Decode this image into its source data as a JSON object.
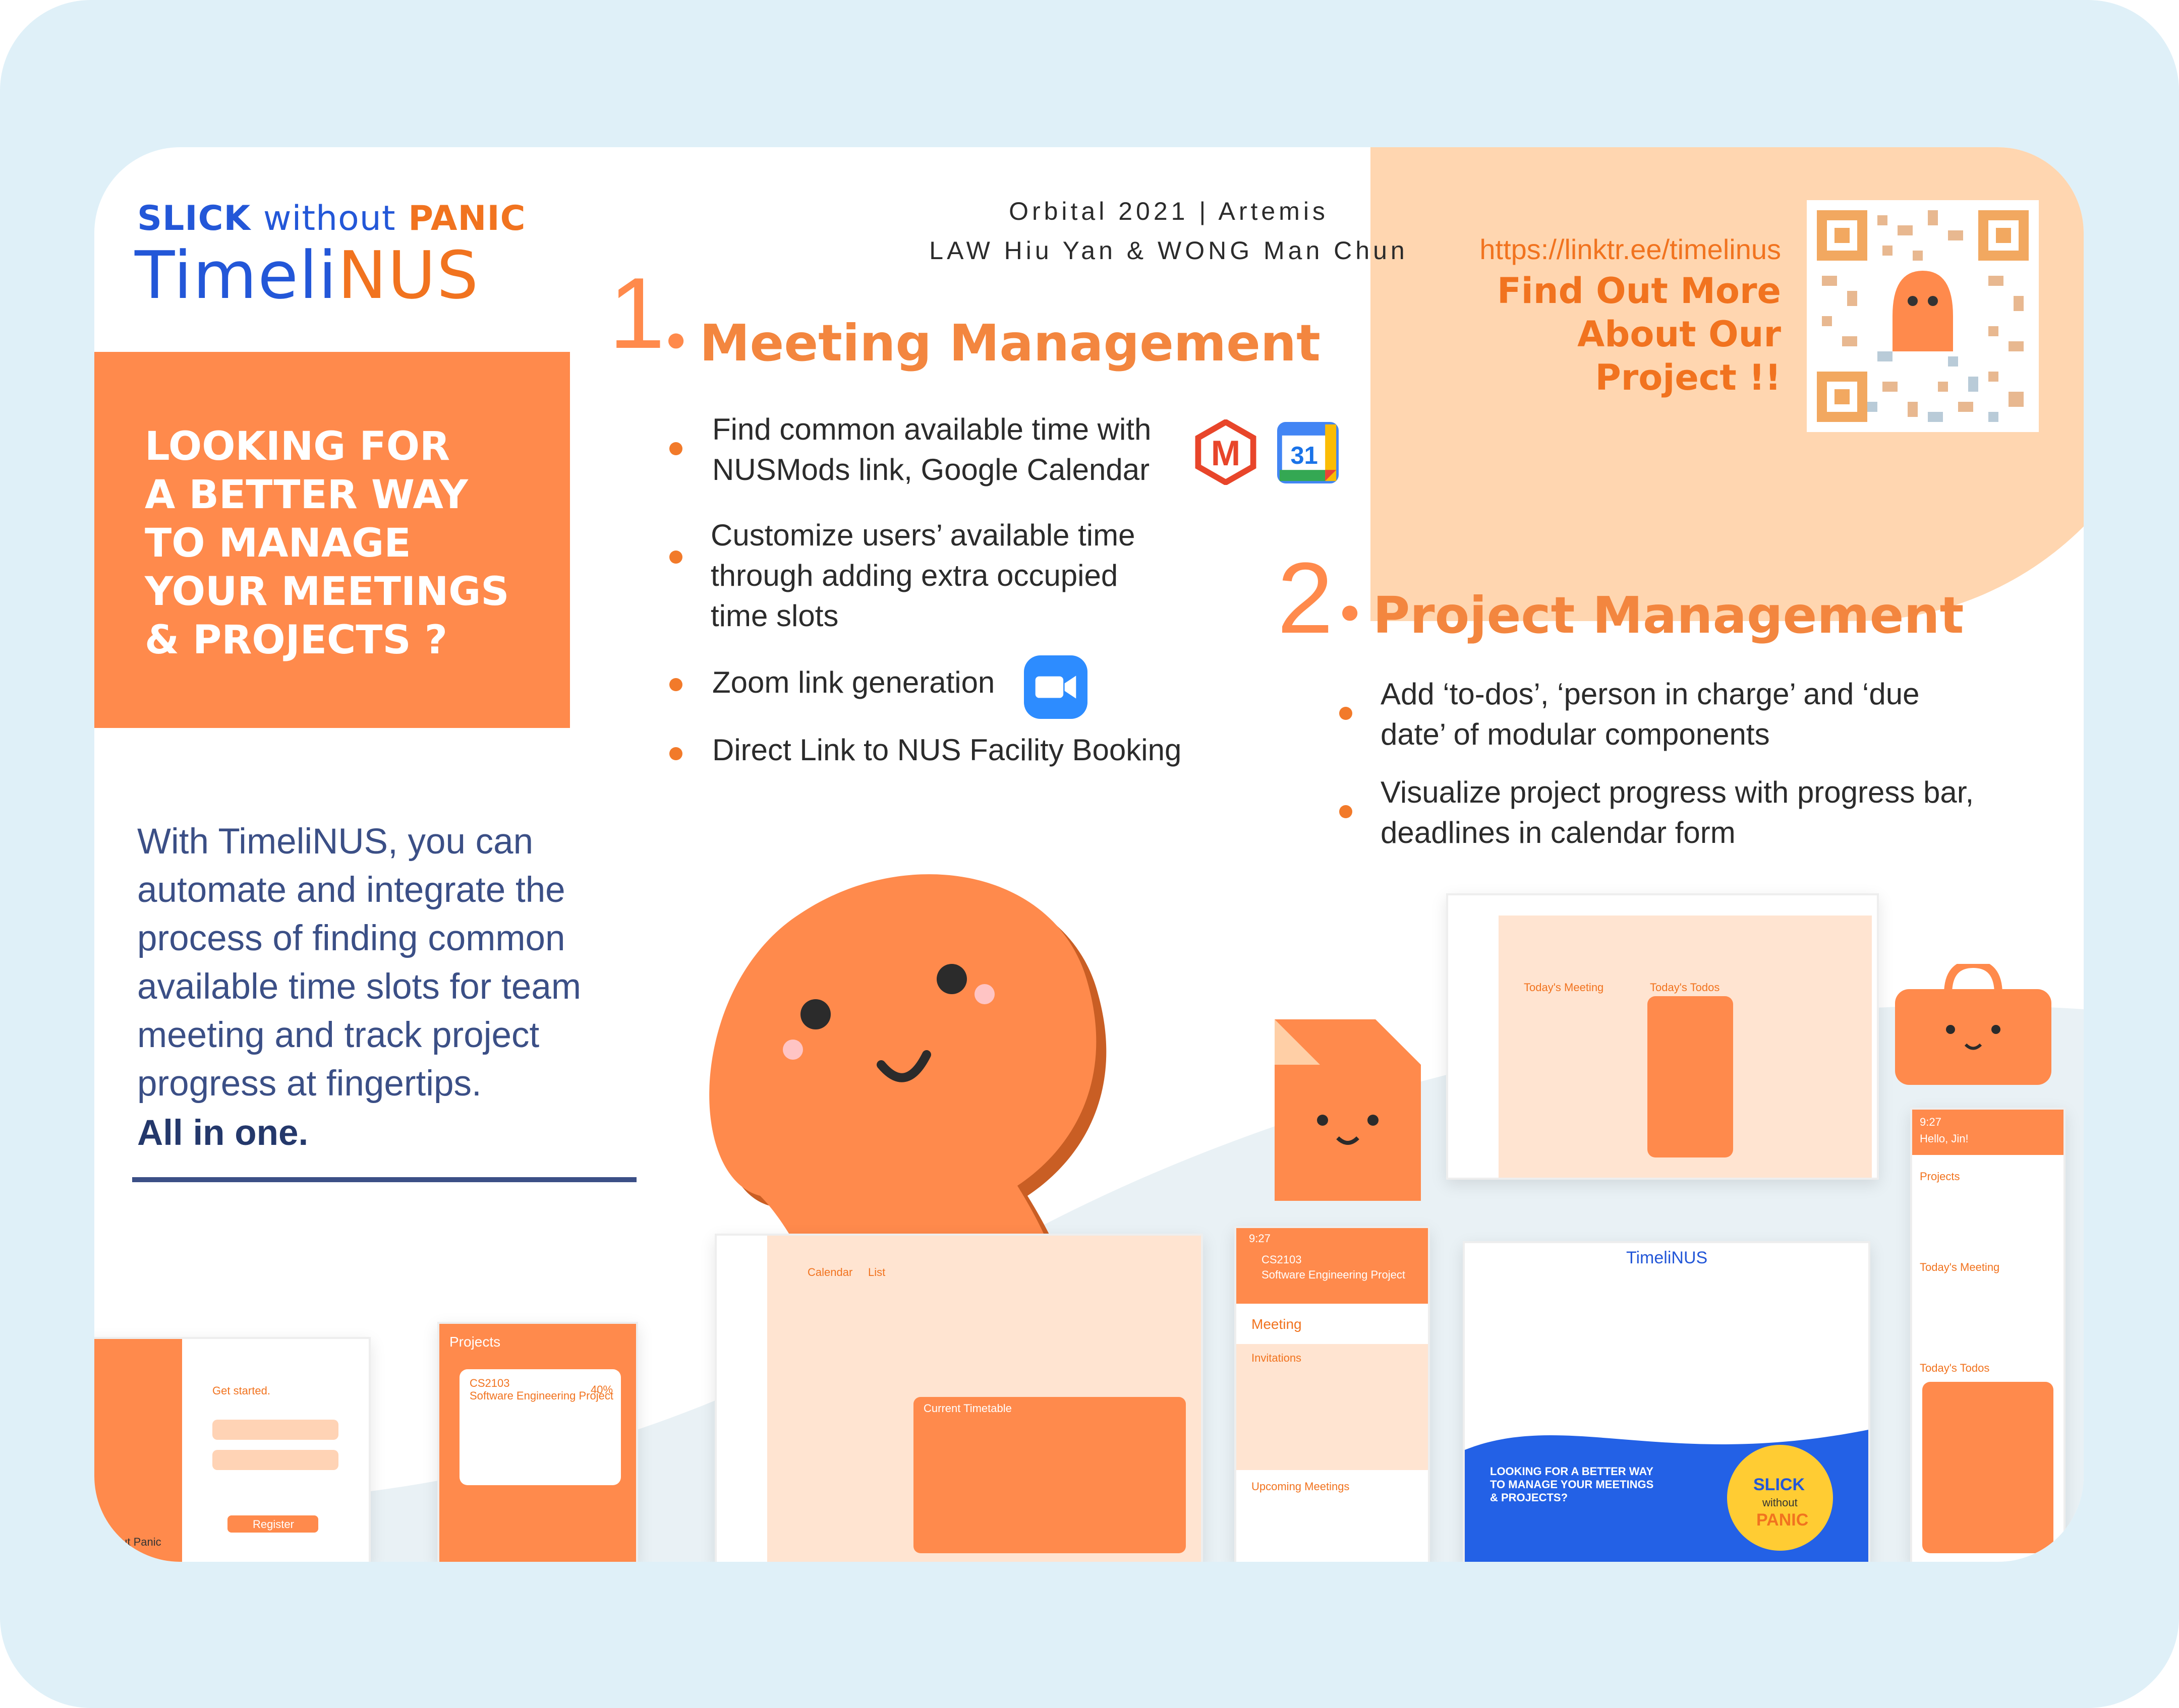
{
  "header": {
    "slick": "SLICK",
    "without": "without",
    "panic": "PANIC",
    "brand_part1": "Timeli",
    "brand_part2": "NUS",
    "orbital_line1": "Orbital 2021 | Artemis",
    "orbital_line2": "LAW Hiu Yan & WONG Man Chun"
  },
  "callout": {
    "line1": "LOOKING FOR",
    "line2": "A BETTER WAY",
    "line3": "TO MANAGE",
    "line4": "YOUR MEETINGS",
    "line5": "& PROJECTS ?"
  },
  "intro": {
    "text": "With TimeliNUS, you can automate and integrate the process of finding common available time slots for team meeting and track project progress at fingertips.",
    "strong": "All in one."
  },
  "qr": {
    "link": "https://linktr.ee/timelinus",
    "find1": "Find Out More",
    "find2": "About Our",
    "find3": "Project !!"
  },
  "section1": {
    "num": "1",
    "title": "Meeting Management",
    "bullets": [
      "Find common available time with NUSMods link, Google Calendar",
      "Customize users’ available time through adding extra occupied time slots",
      "Zoom link generation",
      "Direct Link to NUS Facility Booking"
    ],
    "icons": {
      "nusmods": "M",
      "gcal": "31"
    }
  },
  "section2": {
    "num": "2",
    "title": "Project Management",
    "bullets": [
      "Add ‘to-dos’, ‘person in charge’ and ‘due date’ of modular components",
      "Visualize project progress with progress bar, deadlines in calendar form"
    ]
  },
  "screens": {
    "get_started": "Get started.",
    "about_panic": "About Panic",
    "register": "Register",
    "projects": "Projects",
    "cs2103": "CS2103",
    "sep": "Software Engineering Project",
    "meeting": "Meeting",
    "invitations": "Invitations",
    "upcoming": "Upcoming Meetings",
    "calendar": "Calendar",
    "list": "List",
    "current_timetable": "Current Timetable",
    "hello": "Hello, Jin!",
    "todays_meeting": "Today's Meeting",
    "todays_todos": "Today's Todos",
    "looking_mini": "LOOKING FOR A BETTER WAY TO MANAGE YOUR MEETINGS & PROJECTS?",
    "slick_mini": "SLICK",
    "without_mini": "without",
    "panic_mini": "PANIC",
    "brand_mini": "TimeliNUS",
    "pct": "40%",
    "time1": "9:27"
  },
  "colors": {
    "orange": "#ff8a4c",
    "blue": "#2357d8",
    "navy": "#3b4f86",
    "peach": "#ffd6b0"
  }
}
